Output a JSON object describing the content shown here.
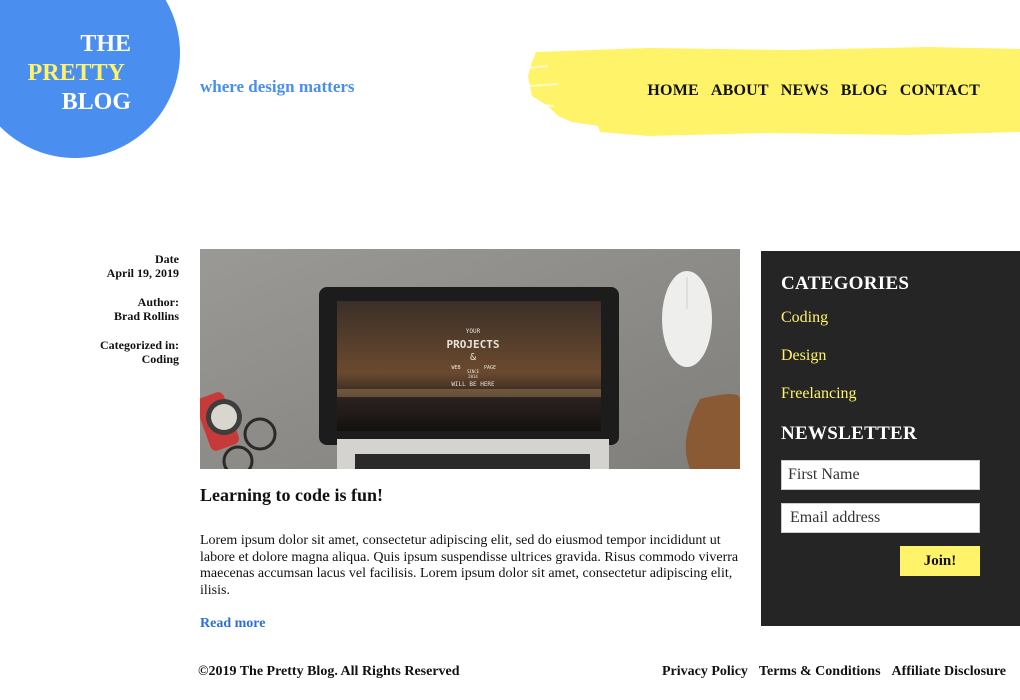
{
  "brand": {
    "line1": "THE",
    "line2": "PRETTY",
    "line3": "BLOG",
    "tagline": "where design matters",
    "colors": {
      "blue": "#4a8ef0",
      "yellow": "#fff36a",
      "dark": "#252525"
    }
  },
  "nav": {
    "items": [
      "HOME",
      "ABOUT",
      "NEWS",
      "BLOG",
      "CONTACT"
    ]
  },
  "post": {
    "meta": {
      "date_label": "Date",
      "date_value": "April 19, 2019",
      "author_label": "Author:",
      "author_value": "Brad Rollins",
      "category_label": "Categorized in:",
      "category_value": "Coding"
    },
    "image": {
      "screen_line1": "YOUR",
      "screen_line2": "PROJECTS",
      "screen_line3": "&",
      "screen_line4": "WEB",
      "screen_line5": "PAGE",
      "screen_line6": "SINCE",
      "screen_line7": "2014",
      "screen_line8": "WILL BE HERE"
    },
    "title": "Learning to code is fun!",
    "body": "Lorem ipsum dolor sit amet, consectetur adipiscing elit, sed do eiusmod tempor incididunt ut labore et dolore magna aliqua. Quis ipsum suspendisse ultrices gravida. Risus commodo viverra maecenas accumsan lacus vel facilisis. Lorem ipsum dolor sit amet, consectetur adipiscing elit, ilisis.",
    "read_more": "Read more"
  },
  "sidebar": {
    "categories_title": "CATEGORIES",
    "categories": [
      "Coding",
      "Design",
      "Freelancing"
    ],
    "newsletter_title": "NEWSLETTER",
    "first_name_placeholder": "First Name",
    "email_placeholder": "Email address",
    "join_label": "Join!"
  },
  "footer": {
    "copyright": "©2019 The Pretty Blog. All Rights Reserved",
    "links": [
      "Privacy Policy",
      "Terms & Conditions",
      "Affiliate Disclosure"
    ]
  }
}
